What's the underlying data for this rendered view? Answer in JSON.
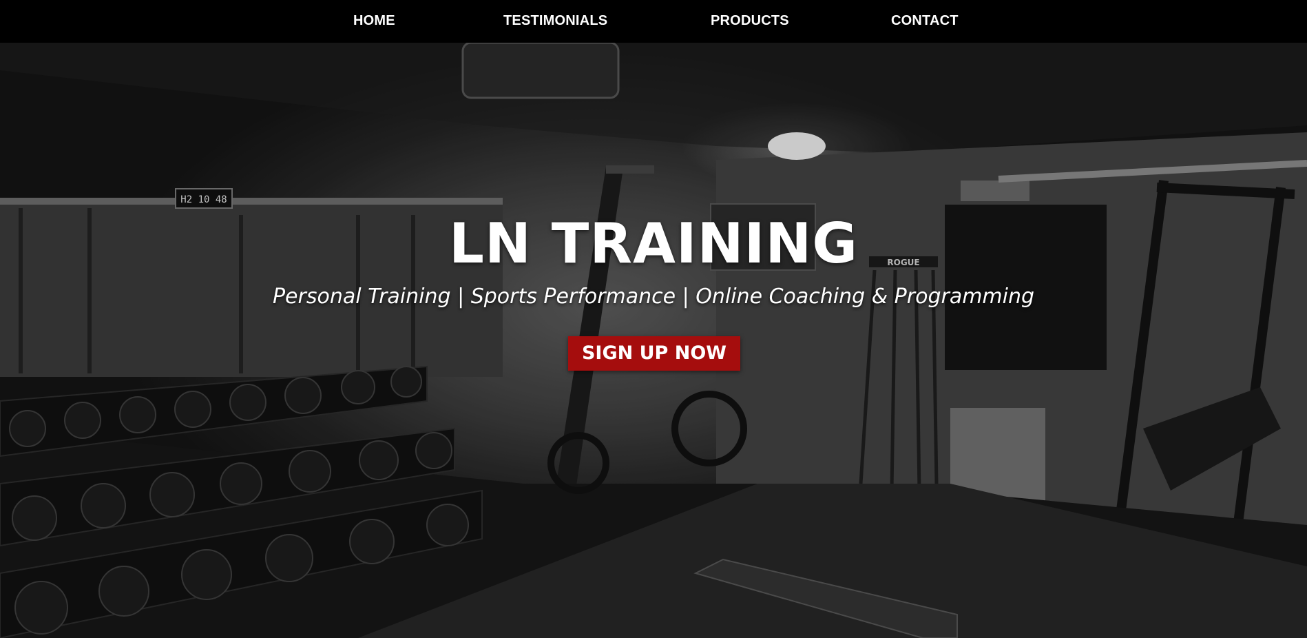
{
  "nav": {
    "items": [
      {
        "label": "HOME"
      },
      {
        "label": "TESTIMONIALS"
      },
      {
        "label": "PRODUCTS"
      },
      {
        "label": "CONTACT"
      }
    ]
  },
  "hero": {
    "title": "LN TRAINING",
    "subtitle": "Personal Training | Sports Performance | Online Coaching & Programming",
    "cta_label": "SIGN UP NOW",
    "background_description_icon": "gym-photo",
    "clock_text": "H2 10 48",
    "rack_brand": "ROGUE"
  },
  "colors": {
    "nav_background": "#000000",
    "cta_background": "#a50d0d",
    "text": "#ffffff"
  }
}
